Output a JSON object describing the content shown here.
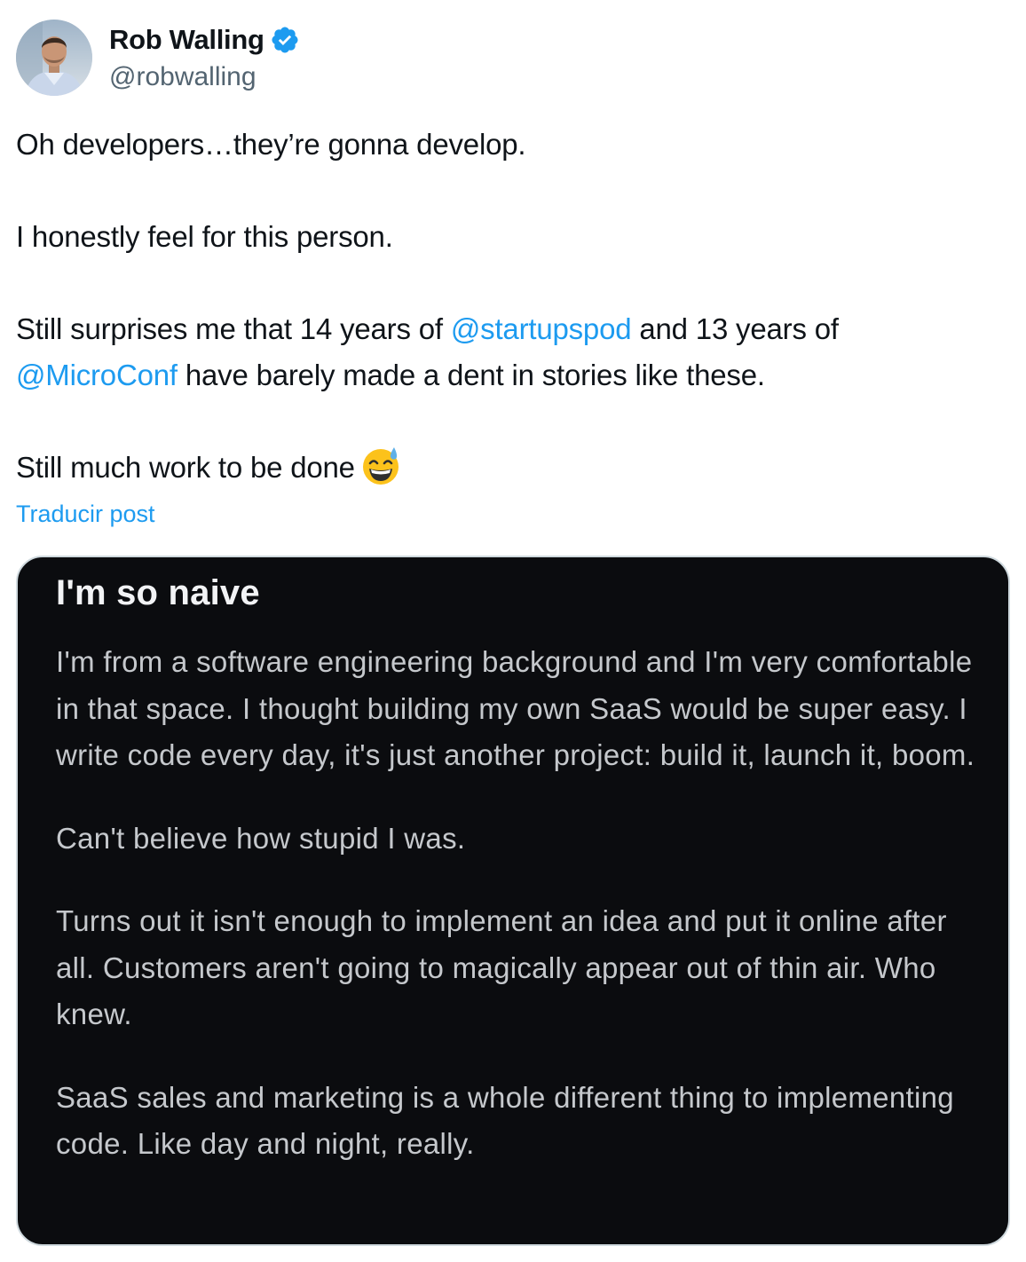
{
  "author": {
    "display_name": "Rob Walling",
    "handle": "@robwalling",
    "verified_icon": "verified-badge-icon",
    "avatar": "profile-photo"
  },
  "tweet": {
    "line1": "Oh developers…they’re gonna develop.",
    "line2": "I honestly feel for this person.",
    "line3_pre": "Still surprises me that 14 years of ",
    "mention1": "@startupspod",
    "line3_mid": " and 13 years of",
    "mention2": "@MicroConf",
    "line3_post": " have barely made a dent in stories like these.",
    "line4": "Still much work to be done",
    "emoji": "grinning-face-with-sweat-icon"
  },
  "translate_label": "Traducir post",
  "embedded_post": {
    "title": "I'm so naive",
    "paragraphs": [
      "I'm from a software engineering background and I'm very comfortable in that space. I thought building my own SaaS would be super easy. I write code every day, it's just another project: build it, launch it, boom.",
      "Can't believe how stupid I was.",
      "Turns out it isn't enough to implement an idea and put it online after all. Customers aren't going to magically appear out of thin air. Who knew.",
      "SaaS sales and marketing is a whole different thing to implementing code. Like day and night, really."
    ]
  },
  "colors": {
    "link": "#1d9bf0",
    "text": "#0f1419",
    "secondary": "#536471",
    "card_bg": "#0b0c0f"
  }
}
